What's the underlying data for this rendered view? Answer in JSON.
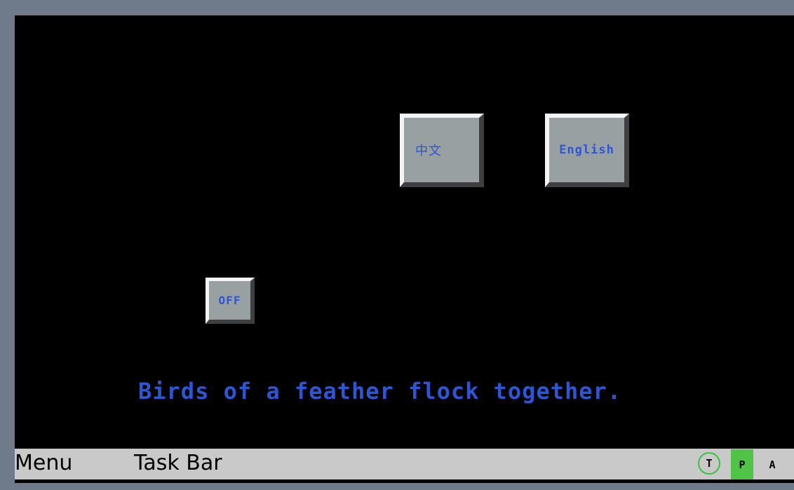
{
  "screen": {
    "buttons": {
      "chinese_label": "中文",
      "english_label": "English",
      "off_label": "OFF"
    },
    "message": "Birds of a feather flock together."
  },
  "taskbar": {
    "menu_label": "Menu",
    "title": "Task Bar",
    "indicators": {
      "t": "T",
      "p": "P",
      "a": "A"
    }
  },
  "colors": {
    "bezel": "#6f7b8a",
    "screen_background": "#000000",
    "button_face": "#98a0a1",
    "accent_text": "#2d56d6",
    "taskbar": "#c9c9c9",
    "indicator_green": "#4fc446"
  }
}
